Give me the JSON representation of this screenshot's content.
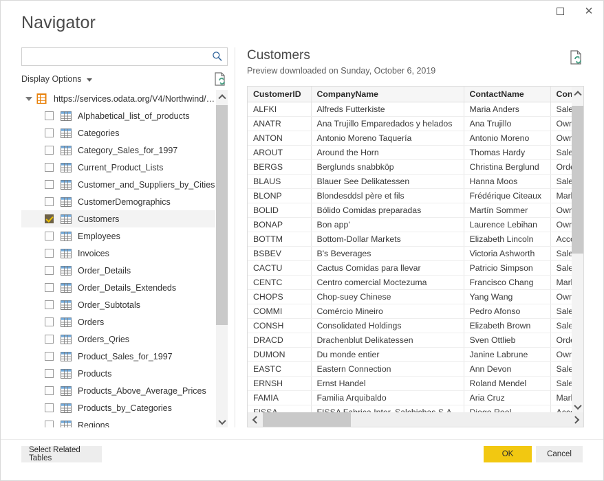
{
  "window": {
    "title": "Navigator",
    "controls": {
      "maximize": "maximize-button",
      "close": "close-button"
    }
  },
  "search": {
    "value": "",
    "placeholder": "",
    "icon": "search-icon"
  },
  "display_options": {
    "label": "Display Options",
    "caret": "chevron-down-icon",
    "refresh_icon": "refresh-document-icon"
  },
  "tree": {
    "root": {
      "label": "https://services.odata.org/V4/Northwind/N...",
      "expanded": true,
      "icon": "odata-source-icon"
    },
    "items": [
      {
        "label": "Alphabetical_list_of_products",
        "checked": false,
        "selected": false
      },
      {
        "label": "Categories",
        "checked": false,
        "selected": false
      },
      {
        "label": "Category_Sales_for_1997",
        "checked": false,
        "selected": false
      },
      {
        "label": "Current_Product_Lists",
        "checked": false,
        "selected": false
      },
      {
        "label": "Customer_and_Suppliers_by_Cities",
        "checked": false,
        "selected": false
      },
      {
        "label": "CustomerDemographics",
        "checked": false,
        "selected": false
      },
      {
        "label": "Customers",
        "checked": true,
        "selected": true
      },
      {
        "label": "Employees",
        "checked": false,
        "selected": false
      },
      {
        "label": "Invoices",
        "checked": false,
        "selected": false
      },
      {
        "label": "Order_Details",
        "checked": false,
        "selected": false
      },
      {
        "label": "Order_Details_Extendeds",
        "checked": false,
        "selected": false
      },
      {
        "label": "Order_Subtotals",
        "checked": false,
        "selected": false
      },
      {
        "label": "Orders",
        "checked": false,
        "selected": false
      },
      {
        "label": "Orders_Qries",
        "checked": false,
        "selected": false
      },
      {
        "label": "Product_Sales_for_1997",
        "checked": false,
        "selected": false
      },
      {
        "label": "Products",
        "checked": false,
        "selected": false
      },
      {
        "label": "Products_Above_Average_Prices",
        "checked": false,
        "selected": false
      },
      {
        "label": "Products_by_Categories",
        "checked": false,
        "selected": false
      },
      {
        "label": "Regions",
        "checked": false,
        "selected": false
      }
    ]
  },
  "preview": {
    "title": "Customers",
    "subtitle": "Preview downloaded on Sunday, October 6, 2019",
    "refresh_icon": "refresh-preview-icon",
    "columns": [
      "CustomerID",
      "CompanyName",
      "ContactName",
      "ContactTitle"
    ],
    "rows": [
      [
        "ALFKI",
        "Alfreds Futterkiste",
        "Maria Anders",
        "Sales Representative"
      ],
      [
        "ANATR",
        "Ana Trujillo Emparedados y helados",
        "Ana Trujillo",
        "Owner"
      ],
      [
        "ANTON",
        "Antonio Moreno Taquería",
        "Antonio Moreno",
        "Owner"
      ],
      [
        "AROUT",
        "Around the Horn",
        "Thomas Hardy",
        "Sales Representative"
      ],
      [
        "BERGS",
        "Berglunds snabbköp",
        "Christina Berglund",
        "Order Administrator"
      ],
      [
        "BLAUS",
        "Blauer See Delikatessen",
        "Hanna Moos",
        "Sales Representative"
      ],
      [
        "BLONP",
        "Blondesddsl père et fils",
        "Frédérique Citeaux",
        "Marketing Manager"
      ],
      [
        "BOLID",
        "Bólido Comidas preparadas",
        "Martín Sommer",
        "Owner"
      ],
      [
        "BONAP",
        "Bon app'",
        "Laurence Lebihan",
        "Owner"
      ],
      [
        "BOTTM",
        "Bottom-Dollar Markets",
        "Elizabeth Lincoln",
        "Accounting Manager"
      ],
      [
        "BSBEV",
        "B's Beverages",
        "Victoria Ashworth",
        "Sales Representative"
      ],
      [
        "CACTU",
        "Cactus Comidas para llevar",
        "Patricio Simpson",
        "Sales Agent"
      ],
      [
        "CENTC",
        "Centro comercial Moctezuma",
        "Francisco Chang",
        "Marketing Manager"
      ],
      [
        "CHOPS",
        "Chop-suey Chinese",
        "Yang Wang",
        "Owner"
      ],
      [
        "COMMI",
        "Comércio Mineiro",
        "Pedro Afonso",
        "Sales Associate"
      ],
      [
        "CONSH",
        "Consolidated Holdings",
        "Elizabeth Brown",
        "Sales Representative"
      ],
      [
        "DRACD",
        "Drachenblut Delikatessen",
        "Sven Ottlieb",
        "Order Administrator"
      ],
      [
        "DUMON",
        "Du monde entier",
        "Janine Labrune",
        "Owner"
      ],
      [
        "EASTC",
        "Eastern Connection",
        "Ann Devon",
        "Sales Agent"
      ],
      [
        "ERNSH",
        "Ernst Handel",
        "Roland Mendel",
        "Sales Manager"
      ],
      [
        "FAMIA",
        "Familia Arquibaldo",
        "Aria Cruz",
        "Marketing Assistant"
      ],
      [
        "FISSA",
        "FISSA Fabrica Inter. Salchichas S.A.",
        "Diego Roel",
        "Accounting Manager"
      ]
    ]
  },
  "footer": {
    "select_related_label": "Select Related Tables",
    "ok_label": "OK",
    "cancel_label": "Cancel"
  },
  "colors": {
    "accent_yellow": "#f2c811",
    "source_orange": "#e8820c",
    "link_blue": "#2a6099",
    "refresh_green": "#3f9c7f"
  }
}
